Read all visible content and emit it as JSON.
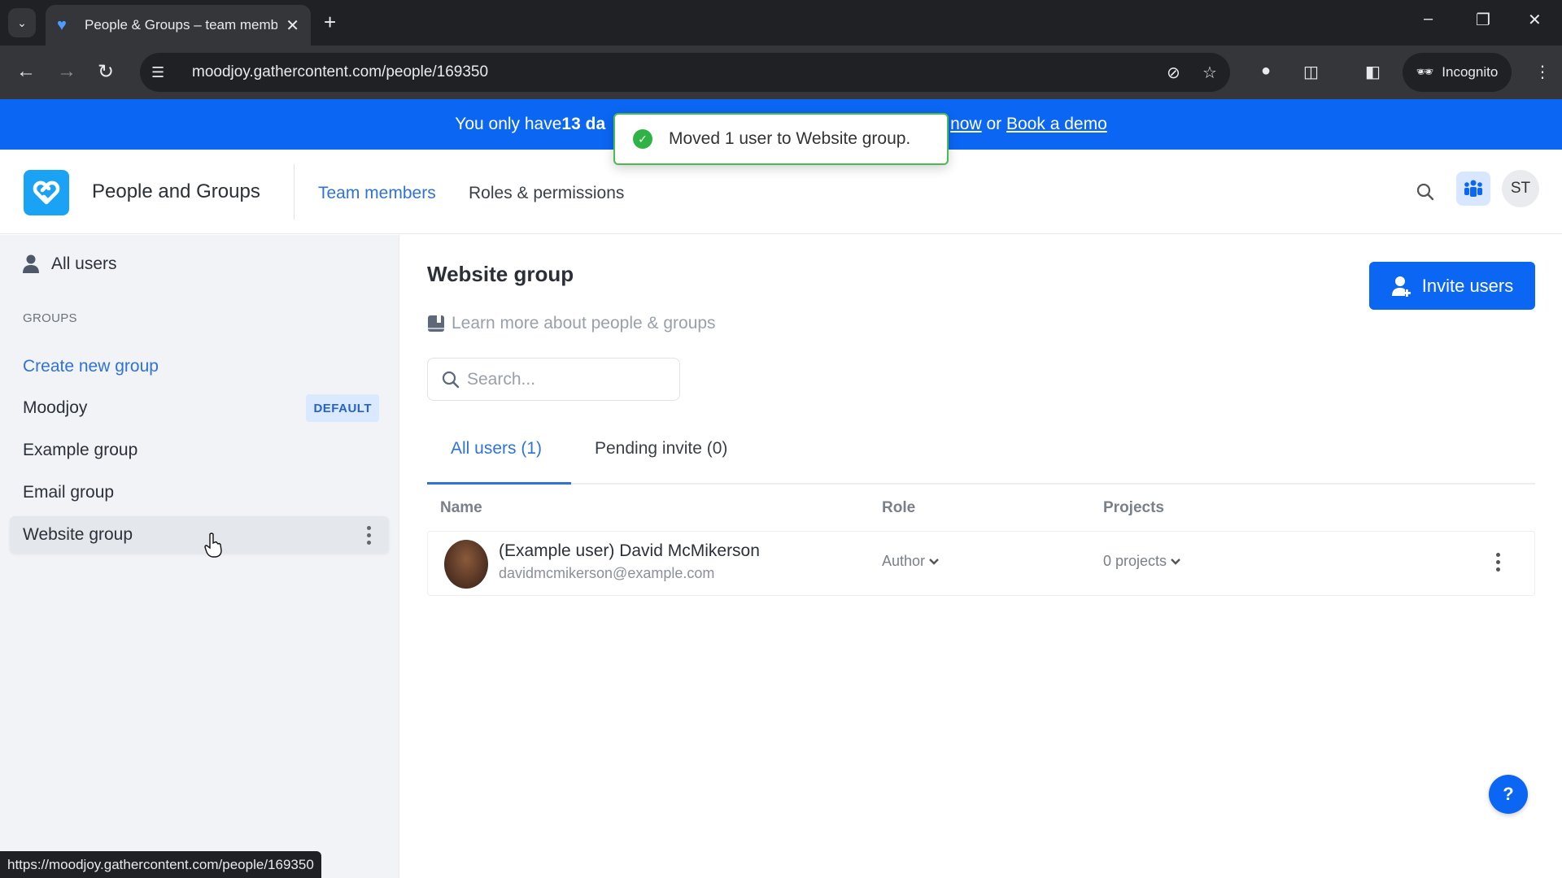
{
  "browser": {
    "tab_title": "People & Groups – team memb",
    "url": "moodjoy.gathercontent.com/people/169350",
    "incognito_label": "Incognito",
    "status_url": "https://moodjoy.gathercontent.com/people/169350"
  },
  "banner": {
    "prefix": "You only have ",
    "days_bold": "13 da",
    "link_now": "now",
    "or_text": " or ",
    "link_demo": "Book a demo",
    "color": "#0b66f3"
  },
  "toast": {
    "message": "Moved 1 user to Website group.",
    "status": "success",
    "color": "#2fb344"
  },
  "header": {
    "app_title": "People and Groups",
    "nav": [
      {
        "label": "Team members",
        "active": true
      },
      {
        "label": "Roles & permissions",
        "active": false
      }
    ],
    "avatar_initials": "ST"
  },
  "sidebar": {
    "all_users_label": "All users",
    "groups_heading": "GROUPS",
    "create_group_label": "Create new group",
    "groups": [
      {
        "name": "Moodjoy",
        "badge": "DEFAULT",
        "selected": false
      },
      {
        "name": "Example group",
        "selected": false
      },
      {
        "name": "Email group",
        "selected": false
      },
      {
        "name": "Website group",
        "selected": true
      }
    ]
  },
  "main": {
    "title": "Website group",
    "learn_more": "Learn more about people & groups",
    "search_placeholder": "Search...",
    "invite_button": "Invite users",
    "tabs": [
      {
        "label": "All users (1)",
        "active": true
      },
      {
        "label": "Pending invite (0)",
        "active": false
      }
    ],
    "columns": [
      "Name",
      "Role",
      "Projects"
    ],
    "rows": [
      {
        "name": "(Example user) David McMikerson",
        "email": "davidmcmikerson@example.com",
        "role": "Author",
        "projects": "0 projects"
      }
    ],
    "help_label": "?"
  }
}
